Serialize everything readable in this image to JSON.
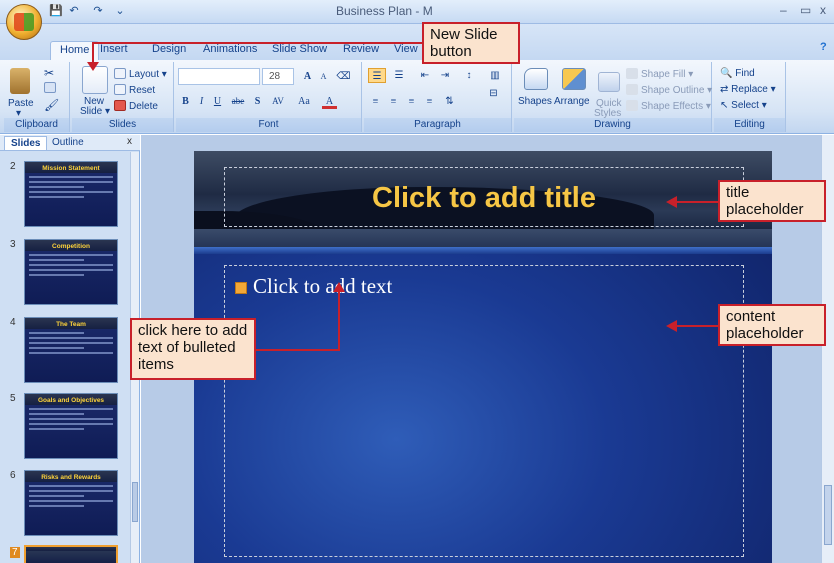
{
  "window": {
    "title": "Business Plan - M",
    "controls": [
      "–",
      "▭",
      "x"
    ],
    "help": "?"
  },
  "tabs": [
    "Home",
    "Insert",
    "Design",
    "Animations",
    "Slide Show",
    "Review",
    "View"
  ],
  "ribbon": {
    "clipboard": {
      "label": "Clipboard",
      "paste": "Paste"
    },
    "slides": {
      "label": "Slides",
      "new_slide_line1": "New",
      "new_slide_line2": "Slide",
      "layout": "Layout",
      "reset": "Reset",
      "delete": "Delete"
    },
    "font": {
      "label": "Font",
      "size": "28",
      "grow": "A",
      "shrink": "A",
      "bold": "B",
      "italic": "I",
      "underline": "U",
      "strike": "abe",
      "shadow": "S",
      "spacing": "AV",
      "case": "Aa",
      "color": "A"
    },
    "paragraph": {
      "label": "Paragraph"
    },
    "drawing": {
      "label": "Drawing",
      "shapes": "Shapes",
      "arrange": "Arrange",
      "quick_styles_line1": "Quick",
      "quick_styles_line2": "Styles",
      "shape_fill": "Shape Fill",
      "shape_outline": "Shape Outline",
      "shape_effects": "Shape Effects"
    },
    "editing": {
      "label": "Editing",
      "find": "Find",
      "replace": "Replace",
      "select": "Select"
    }
  },
  "slides_pane": {
    "tabs": [
      "Slides",
      "Outline"
    ],
    "close": "x",
    "thumbnails": [
      {
        "num": "2",
        "title": "Mission Statement"
      },
      {
        "num": "3",
        "title": "Competition"
      },
      {
        "num": "4",
        "title": "The Team"
      },
      {
        "num": "5",
        "title": "Goals and Objectives"
      },
      {
        "num": "6",
        "title": "Risks and Rewards"
      },
      {
        "num": "7",
        "title": ""
      }
    ]
  },
  "slide": {
    "title_placeholder": "Click to add title",
    "content_placeholder": "Click to add text"
  },
  "callouts": {
    "new_slide": "New Slide button",
    "title": "title placeholder",
    "content": "content placeholder",
    "bullets": "click here to add text of bulleted items"
  },
  "colors": {
    "callout_border": "#c8202a",
    "callout_fill": "#fbe3ce",
    "title_text": "#f6c645",
    "bullet": "#f3a838"
  }
}
